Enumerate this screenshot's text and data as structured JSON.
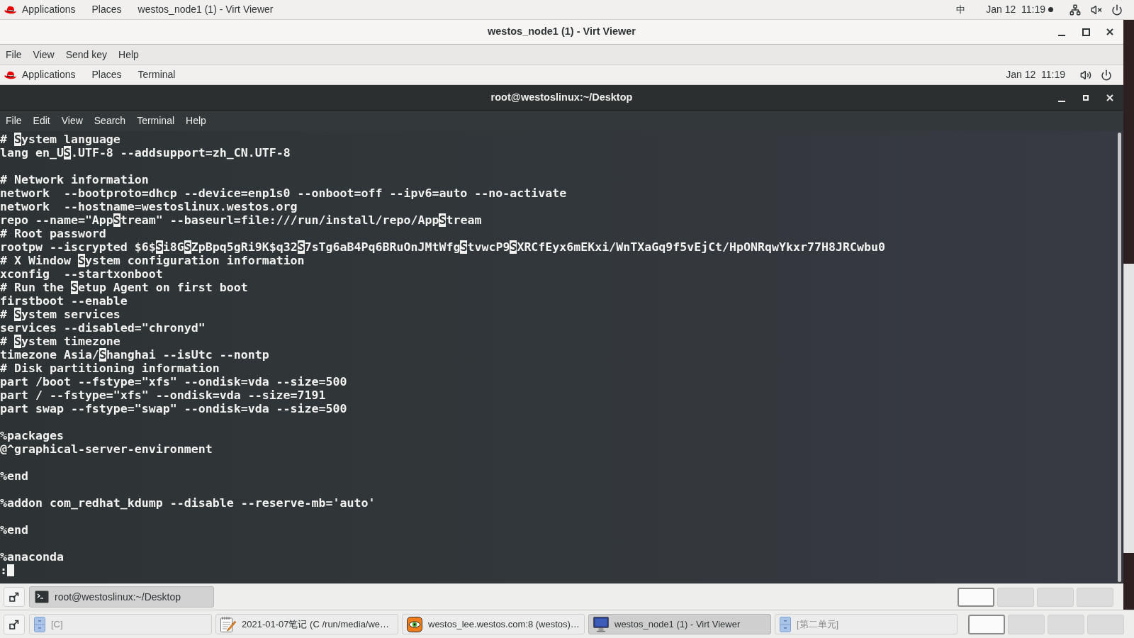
{
  "top_bar": {
    "menus": [
      "Applications",
      "Places",
      "westos_node1 (1) - Virt Viewer"
    ],
    "input_method": "中",
    "clock": "Jan 12  11:19",
    "notification_dot": true,
    "muted": true
  },
  "window": {
    "title": "westos_node1 (1) - Virt Viewer",
    "menu": [
      "File",
      "View",
      "Send key",
      "Help"
    ]
  },
  "guest": {
    "top_bar": {
      "menus": [
        "Applications",
        "Places",
        "Terminal"
      ],
      "clock": "Jan 12  11:19",
      "notification_dot": false,
      "muted": false
    },
    "terminal": {
      "title": "root@westoslinux:~/Desktop",
      "menu": [
        "File",
        "Edit",
        "View",
        "Search",
        "Terminal",
        "Help"
      ],
      "lines": [
        {
          "kind": "text",
          "spans": [
            {
              "text": "# ",
              "highlighted": false
            },
            {
              "text": "S",
              "highlighted": true
            },
            {
              "text": "ystem language",
              "highlighted": false
            }
          ]
        },
        {
          "kind": "text",
          "spans": [
            {
              "text": "lang en_U",
              "highlighted": false
            },
            {
              "text": "S",
              "highlighted": true
            },
            {
              "text": ".UTF-8 --addsupport=zh_CN.UTF-8",
              "highlighted": false
            }
          ]
        },
        {
          "kind": "blank"
        },
        {
          "kind": "text",
          "spans": [
            {
              "text": "# Network information",
              "highlighted": false
            }
          ]
        },
        {
          "kind": "text",
          "spans": [
            {
              "text": "network  --bootproto=dhcp --device=enp1s0 --onboot=off --ipv6=auto --no-activate",
              "highlighted": false
            }
          ]
        },
        {
          "kind": "text",
          "spans": [
            {
              "text": "network  --hostname=westoslinux.westos.org",
              "highlighted": false
            }
          ]
        },
        {
          "kind": "text",
          "spans": [
            {
              "text": "repo --name=\"App",
              "highlighted": false
            },
            {
              "text": "S",
              "highlighted": true
            },
            {
              "text": "tream\" --baseurl=file:///run/install/repo/App",
              "highlighted": false
            },
            {
              "text": "S",
              "highlighted": true
            },
            {
              "text": "tream",
              "highlighted": false
            }
          ]
        },
        {
          "kind": "text",
          "spans": [
            {
              "text": "# Root password",
              "highlighted": false
            }
          ]
        },
        {
          "kind": "text",
          "spans": [
            {
              "text": "rootpw --iscrypted $6$",
              "highlighted": false
            },
            {
              "text": "S",
              "highlighted": true
            },
            {
              "text": "i8G",
              "highlighted": false
            },
            {
              "text": "S",
              "highlighted": true
            },
            {
              "text": "ZpBpq5gRi9K$q32",
              "highlighted": false
            },
            {
              "text": "S",
              "highlighted": true
            },
            {
              "text": "7sTg6aB4Pq6BRuOnJMtWfg",
              "highlighted": false
            },
            {
              "text": "S",
              "highlighted": true
            },
            {
              "text": "tvwcP9",
              "highlighted": false
            },
            {
              "text": "S",
              "highlighted": true
            },
            {
              "text": "XRCfEyx6mEKxi/WnTXaGq9f5vEjCt/HpONRqwYkxr77H8JRCwbu0",
              "highlighted": false
            }
          ]
        },
        {
          "kind": "text",
          "spans": [
            {
              "text": "# X Window ",
              "highlighted": false
            },
            {
              "text": "S",
              "highlighted": true
            },
            {
              "text": "ystem configuration information",
              "highlighted": false
            }
          ]
        },
        {
          "kind": "text",
          "spans": [
            {
              "text": "xconfig  --startxonboot",
              "highlighted": false
            }
          ]
        },
        {
          "kind": "text",
          "spans": [
            {
              "text": "# Run the ",
              "highlighted": false
            },
            {
              "text": "S",
              "highlighted": true
            },
            {
              "text": "etup Agent on first boot",
              "highlighted": false
            }
          ]
        },
        {
          "kind": "text",
          "spans": [
            {
              "text": "firstboot --enable",
              "highlighted": false
            }
          ]
        },
        {
          "kind": "text",
          "spans": [
            {
              "text": "# ",
              "highlighted": false
            },
            {
              "text": "S",
              "highlighted": true
            },
            {
              "text": "ystem services",
              "highlighted": false
            }
          ]
        },
        {
          "kind": "text",
          "spans": [
            {
              "text": "services --disabled=\"chronyd\"",
              "highlighted": false
            }
          ]
        },
        {
          "kind": "text",
          "spans": [
            {
              "text": "# ",
              "highlighted": false
            },
            {
              "text": "S",
              "highlighted": true
            },
            {
              "text": "ystem timezone",
              "highlighted": false
            }
          ]
        },
        {
          "kind": "text",
          "spans": [
            {
              "text": "timezone Asia/",
              "highlighted": false
            },
            {
              "text": "S",
              "highlighted": true
            },
            {
              "text": "hanghai --isUtc --nontp",
              "highlighted": false
            }
          ]
        },
        {
          "kind": "text",
          "spans": [
            {
              "text": "# Disk partitioning information",
              "highlighted": false
            }
          ]
        },
        {
          "kind": "text",
          "spans": [
            {
              "text": "part /boot --fstype=\"xfs\" --ondisk=vda --size=500",
              "highlighted": false
            }
          ]
        },
        {
          "kind": "text",
          "spans": [
            {
              "text": "part / --fstype=\"xfs\" --ondisk=vda --size=7191",
              "highlighted": false
            }
          ]
        },
        {
          "kind": "text",
          "spans": [
            {
              "text": "part swap --fstype=\"swap\" --ondisk=vda --size=500",
              "highlighted": false
            }
          ]
        },
        {
          "kind": "blank"
        },
        {
          "kind": "text",
          "spans": [
            {
              "text": "%packages",
              "highlighted": false
            }
          ]
        },
        {
          "kind": "text",
          "spans": [
            {
              "text": "@^graphical-server-environment",
              "highlighted": false
            }
          ]
        },
        {
          "kind": "blank"
        },
        {
          "kind": "text",
          "spans": [
            {
              "text": "%end",
              "highlighted": false
            }
          ]
        },
        {
          "kind": "blank"
        },
        {
          "kind": "text",
          "spans": [
            {
              "text": "%addon com_redhat_kdump --disable --reserve-mb='auto'",
              "highlighted": false
            }
          ]
        },
        {
          "kind": "blank"
        },
        {
          "kind": "text",
          "spans": [
            {
              "text": "%end",
              "highlighted": false
            }
          ]
        },
        {
          "kind": "blank"
        },
        {
          "kind": "text",
          "spans": [
            {
              "text": "%anaconda",
              "highlighted": false
            }
          ]
        }
      ],
      "command_line": {
        "text": ":",
        "cursor": true
      }
    },
    "taskbar": {
      "windows": [
        {
          "label": "root@westoslinux:~/Desktop",
          "selected": true,
          "minimized": false
        }
      ],
      "workspaces": [
        {
          "selected": true
        },
        {
          "selected": false
        },
        {
          "selected": false
        },
        {
          "selected": false
        }
      ]
    }
  },
  "taskbar": {
    "windows": [
      {
        "label": "[C]",
        "selected": false,
        "minimized": true
      },
      {
        "label": "2021-01-07笔记 (C /run/media/we…",
        "selected": false,
        "minimized": false
      },
      {
        "label": "westos_lee.westos.com:8 (westos)…",
        "selected": false,
        "minimized": false
      },
      {
        "label": "westos_node1 (1) - Virt Viewer",
        "selected": true,
        "minimized": false
      },
      {
        "label": "[第二单元]",
        "selected": false,
        "minimized": true
      }
    ],
    "workspaces": [
      {
        "selected": true
      },
      {
        "selected": false
      },
      {
        "selected": false
      },
      {
        "selected": false
      }
    ]
  }
}
